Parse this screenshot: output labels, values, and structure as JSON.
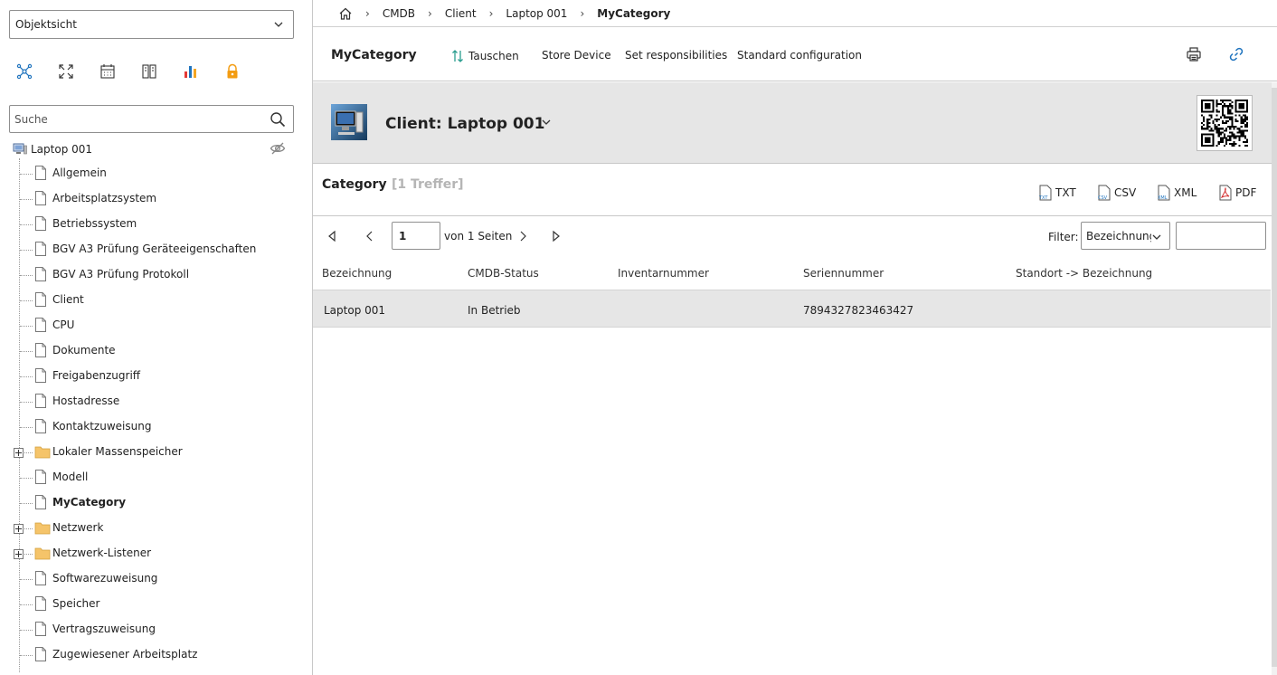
{
  "sidebar": {
    "view_select": "Objektsicht",
    "search_placeholder": "Suche",
    "tree": {
      "root": "Laptop 001",
      "items": [
        {
          "label": "Allgemein",
          "type": "doc"
        },
        {
          "label": "Arbeitsplatzsystem",
          "type": "doc"
        },
        {
          "label": "Betriebssystem",
          "type": "doc"
        },
        {
          "label": "BGV A3 Prüfung Geräteeigenschaften",
          "type": "doc"
        },
        {
          "label": "BGV A3 Prüfung Protokoll",
          "type": "doc"
        },
        {
          "label": "Client",
          "type": "doc"
        },
        {
          "label": "CPU",
          "type": "doc"
        },
        {
          "label": "Dokumente",
          "type": "doc"
        },
        {
          "label": "Freigabenzugriff",
          "type": "doc"
        },
        {
          "label": "Hostadresse",
          "type": "doc"
        },
        {
          "label": "Kontaktzuweisung",
          "type": "doc"
        },
        {
          "label": "Lokaler Massenspeicher",
          "type": "folder"
        },
        {
          "label": "Modell",
          "type": "doc"
        },
        {
          "label": "MyCategory",
          "type": "doc",
          "selected": true
        },
        {
          "label": "Netzwerk",
          "type": "folder"
        },
        {
          "label": "Netzwerk-Listener",
          "type": "folder"
        },
        {
          "label": "Softwarezuweisung",
          "type": "doc"
        },
        {
          "label": "Speicher",
          "type": "doc"
        },
        {
          "label": "Vertragszuweisung",
          "type": "doc"
        },
        {
          "label": "Zugewiesener Arbeitsplatz",
          "type": "doc"
        }
      ]
    }
  },
  "breadcrumb": [
    "CMDB",
    "Client",
    "Laptop 001",
    "MyCategory"
  ],
  "toolbar": {
    "title": "MyCategory",
    "swap": "Tauschen",
    "store_device": "Store Device",
    "set_responsibilities": "Set responsibilities",
    "standard_configuration": "Standard configuration"
  },
  "object": {
    "title": "Client: Laptop 001"
  },
  "category": {
    "title": "Category",
    "hits": "[1 Treffer]",
    "exports": {
      "txt": "TXT",
      "csv": "CSV",
      "xml": "XML",
      "pdf": "PDF"
    }
  },
  "pager": {
    "page": "1",
    "of_pages": "von 1 Seiten",
    "filter_label": "Filter:",
    "filter_field": "Bezeichnung"
  },
  "table": {
    "columns": [
      "Bezeichnung",
      "CMDB-Status",
      "Inventarnummer",
      "Seriennummer",
      "Standort -> Bezeichnung"
    ],
    "rows": [
      [
        "Laptop 001",
        "In Betrieb",
        "",
        "7894327823463427",
        ""
      ]
    ]
  },
  "colors": {
    "accent": "#1e73be",
    "folder": "#f5c46a",
    "pdf": "#d32f2f",
    "header_bg": "#e6e6e6"
  }
}
